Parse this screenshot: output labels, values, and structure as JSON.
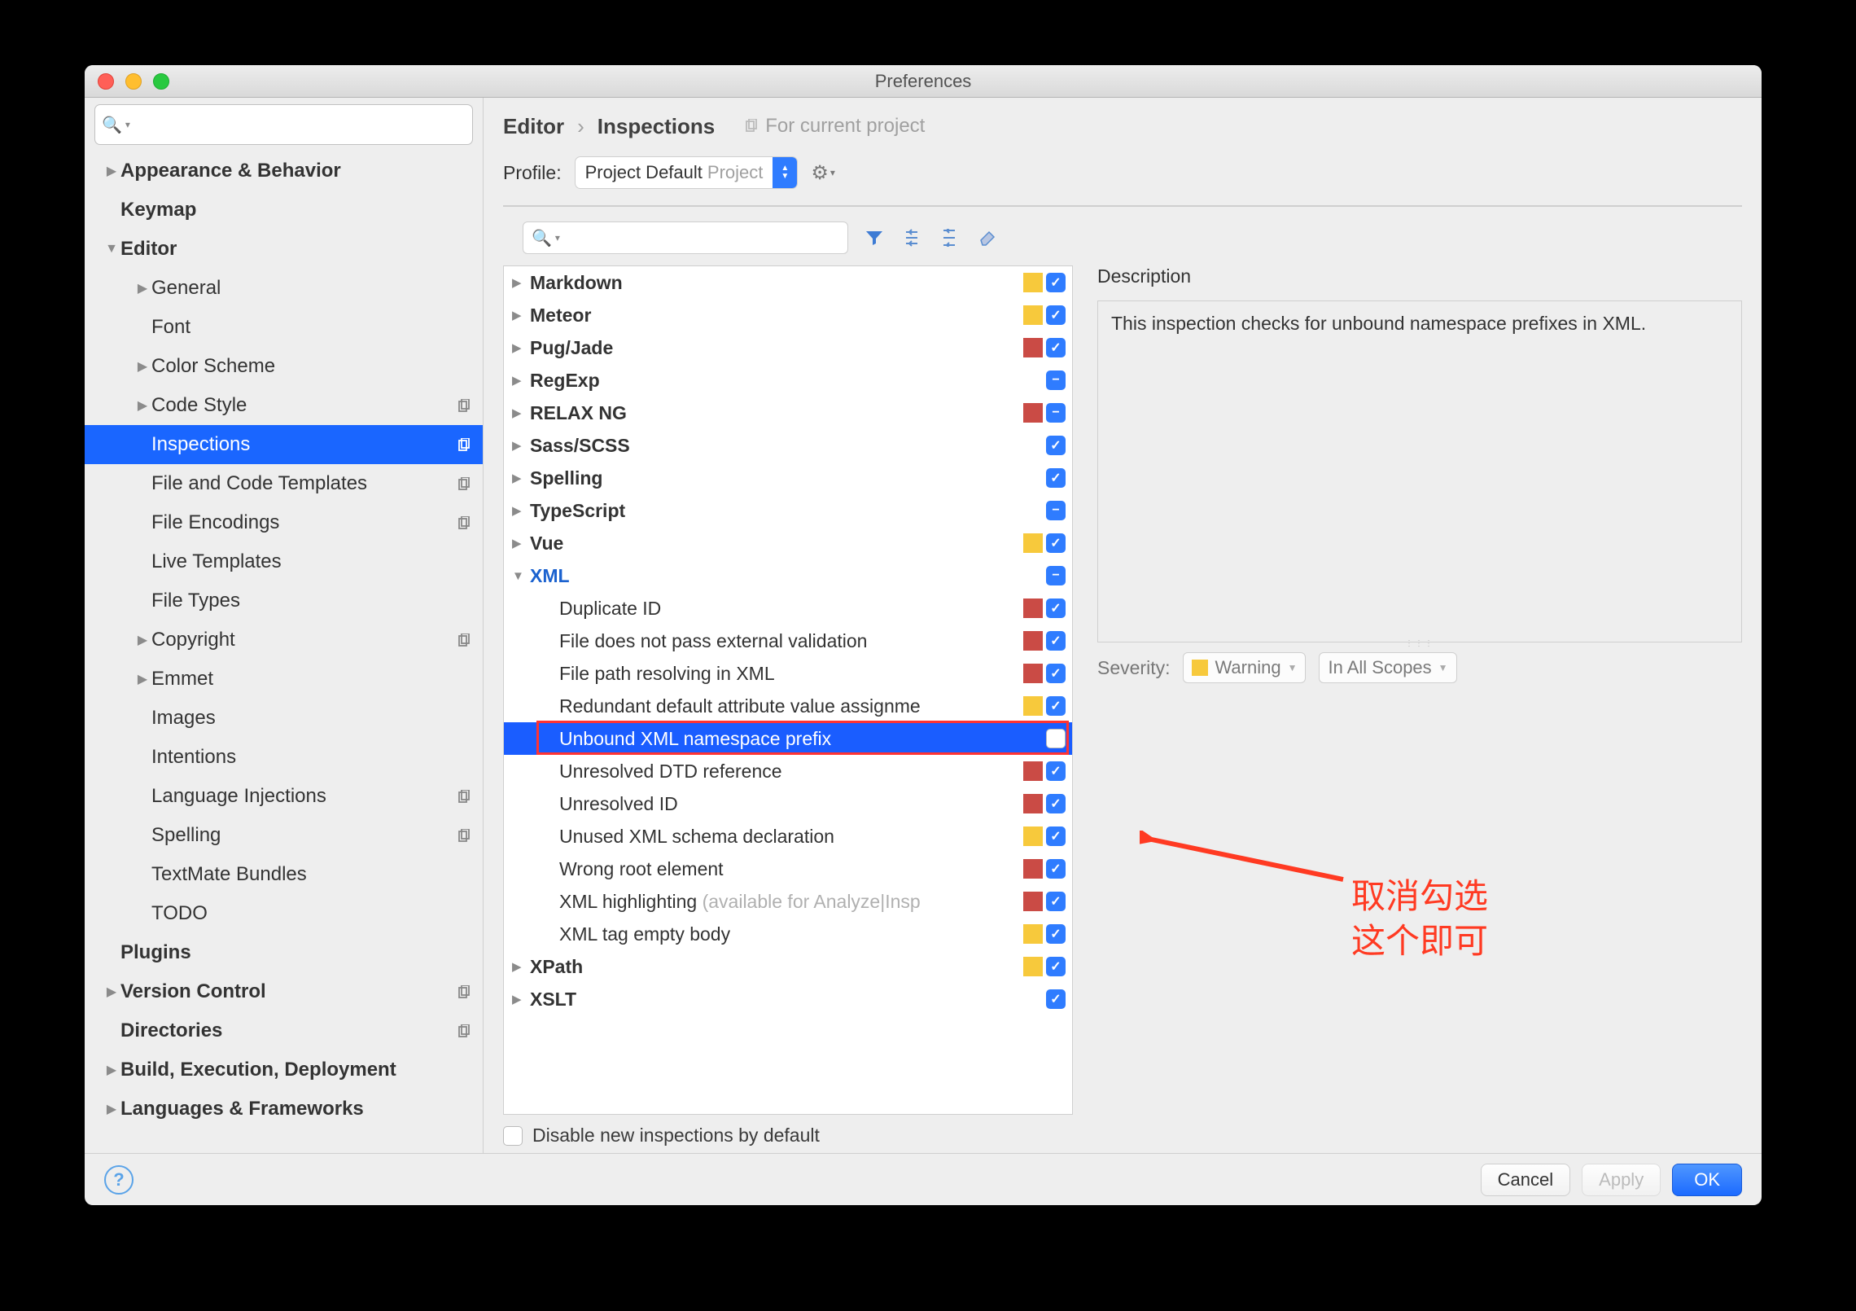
{
  "window_title": "Preferences",
  "sidebar_items": [
    {
      "level": 1,
      "arrow": "right",
      "bold": true,
      "label": "Appearance & Behavior",
      "badge": ""
    },
    {
      "level": 1,
      "arrow": "",
      "bold": true,
      "label": "Keymap",
      "badge": ""
    },
    {
      "level": 1,
      "arrow": "down",
      "bold": true,
      "label": "Editor",
      "badge": ""
    },
    {
      "level": 2,
      "arrow": "right",
      "bold": false,
      "label": "General",
      "badge": ""
    },
    {
      "level": 2,
      "arrow": "",
      "bold": false,
      "label": "Font",
      "badge": ""
    },
    {
      "level": 2,
      "arrow": "right",
      "bold": false,
      "label": "Color Scheme",
      "badge": ""
    },
    {
      "level": 2,
      "arrow": "right",
      "bold": false,
      "label": "Code Style",
      "badge": "copy"
    },
    {
      "level": 2,
      "arrow": "",
      "bold": false,
      "label": "Inspections",
      "badge": "copy",
      "selected": true
    },
    {
      "level": 2,
      "arrow": "",
      "bold": false,
      "label": "File and Code Templates",
      "badge": "copy"
    },
    {
      "level": 2,
      "arrow": "",
      "bold": false,
      "label": "File Encodings",
      "badge": "copy"
    },
    {
      "level": 2,
      "arrow": "",
      "bold": false,
      "label": "Live Templates",
      "badge": ""
    },
    {
      "level": 2,
      "arrow": "",
      "bold": false,
      "label": "File Types",
      "badge": ""
    },
    {
      "level": 2,
      "arrow": "right",
      "bold": false,
      "label": "Copyright",
      "badge": "copy"
    },
    {
      "level": 2,
      "arrow": "right",
      "bold": false,
      "label": "Emmet",
      "badge": ""
    },
    {
      "level": 2,
      "arrow": "",
      "bold": false,
      "label": "Images",
      "badge": ""
    },
    {
      "level": 2,
      "arrow": "",
      "bold": false,
      "label": "Intentions",
      "badge": ""
    },
    {
      "level": 2,
      "arrow": "",
      "bold": false,
      "label": "Language Injections",
      "badge": "copy"
    },
    {
      "level": 2,
      "arrow": "",
      "bold": false,
      "label": "Spelling",
      "badge": "copy"
    },
    {
      "level": 2,
      "arrow": "",
      "bold": false,
      "label": "TextMate Bundles",
      "badge": ""
    },
    {
      "level": 2,
      "arrow": "",
      "bold": false,
      "label": "TODO",
      "badge": ""
    },
    {
      "level": 1,
      "arrow": "",
      "bold": true,
      "label": "Plugins",
      "badge": ""
    },
    {
      "level": 1,
      "arrow": "right",
      "bold": true,
      "label": "Version Control",
      "badge": "copy"
    },
    {
      "level": 1,
      "arrow": "",
      "bold": true,
      "label": "Directories",
      "badge": "copy"
    },
    {
      "level": 1,
      "arrow": "right",
      "bold": true,
      "label": "Build, Execution, Deployment",
      "badge": ""
    },
    {
      "level": 1,
      "arrow": "right",
      "bold": true,
      "label": "Languages & Frameworks",
      "badge": ""
    }
  ],
  "breadcrumb": {
    "a": "Editor",
    "b": "Inspections",
    "fcp": "For current project"
  },
  "profile": {
    "label": "Profile:",
    "value": "Project Default",
    "scope": "Project"
  },
  "inspections": [
    {
      "arrow": "right",
      "bold": true,
      "label": "Markdown",
      "sev": "yellow",
      "cb": "checked"
    },
    {
      "arrow": "right",
      "bold": true,
      "label": "Meteor",
      "sev": "yellow",
      "cb": "checked"
    },
    {
      "arrow": "right",
      "bold": true,
      "label": "Pug/Jade",
      "sev": "red",
      "cb": "checked"
    },
    {
      "arrow": "right",
      "bold": true,
      "label": "RegExp",
      "sev": "",
      "cb": "mixed"
    },
    {
      "arrow": "right",
      "bold": true,
      "label": "RELAX NG",
      "sev": "red",
      "cb": "mixed"
    },
    {
      "arrow": "right",
      "bold": true,
      "label": "Sass/SCSS",
      "sev": "",
      "cb": "checked"
    },
    {
      "arrow": "right",
      "bold": true,
      "label": "Spelling",
      "sev": "",
      "cb": "checked"
    },
    {
      "arrow": "right",
      "bold": true,
      "label": "TypeScript",
      "sev": "",
      "cb": "mixed"
    },
    {
      "arrow": "right",
      "bold": true,
      "label": "Vue",
      "sev": "yellow",
      "cb": "checked"
    },
    {
      "arrow": "down",
      "bold": true,
      "link": true,
      "label": "XML",
      "sev": "",
      "cb": "mixed"
    },
    {
      "arrow": "",
      "bold": false,
      "indent": true,
      "label": "Duplicate ID",
      "sev": "red",
      "cb": "checked"
    },
    {
      "arrow": "",
      "bold": false,
      "indent": true,
      "label": "File does not pass external validation",
      "sev": "red",
      "cb": "checked"
    },
    {
      "arrow": "",
      "bold": false,
      "indent": true,
      "label": "File path resolving in XML",
      "sev": "red",
      "cb": "checked"
    },
    {
      "arrow": "",
      "bold": false,
      "indent": true,
      "label": "Redundant default attribute value assignme",
      "sev": "yellow",
      "cb": "checked"
    },
    {
      "arrow": "",
      "bold": false,
      "indent": true,
      "label": "Unbound XML namespace prefix",
      "sev": "",
      "cb": "empty",
      "selected": true,
      "redbox": true
    },
    {
      "arrow": "",
      "bold": false,
      "indent": true,
      "label": "Unresolved DTD reference",
      "sev": "red",
      "cb": "checked"
    },
    {
      "arrow": "",
      "bold": false,
      "indent": true,
      "label": "Unresolved ID",
      "sev": "red",
      "cb": "checked"
    },
    {
      "arrow": "",
      "bold": false,
      "indent": true,
      "label": "Unused XML schema declaration",
      "sev": "yellow",
      "cb": "checked"
    },
    {
      "arrow": "",
      "bold": false,
      "indent": true,
      "label": "Wrong root element",
      "sev": "red",
      "cb": "checked"
    },
    {
      "arrow": "",
      "bold": false,
      "indent": true,
      "label": "XML highlighting ",
      "hint": "(available for Analyze|Insp",
      "sev": "red",
      "cb": "checked"
    },
    {
      "arrow": "",
      "bold": false,
      "indent": true,
      "label": "XML tag empty body",
      "sev": "yellow",
      "cb": "checked"
    },
    {
      "arrow": "right",
      "bold": true,
      "label": "XPath",
      "sev": "yellow",
      "cb": "checked"
    },
    {
      "arrow": "right",
      "bold": true,
      "label": "XSLT",
      "sev": "",
      "cb": "checked"
    }
  ],
  "disable_new_label": "Disable new inspections by default",
  "description": {
    "label": "Description",
    "text": "This inspection checks for unbound namespace prefixes in XML."
  },
  "severity": {
    "label": "Severity:",
    "value": "Warning",
    "scope": "In All Scopes"
  },
  "footer": {
    "cancel": "Cancel",
    "apply": "Apply",
    "ok": "OK"
  },
  "annotation": {
    "line1": "取消勾选",
    "line2": "这个即可"
  }
}
